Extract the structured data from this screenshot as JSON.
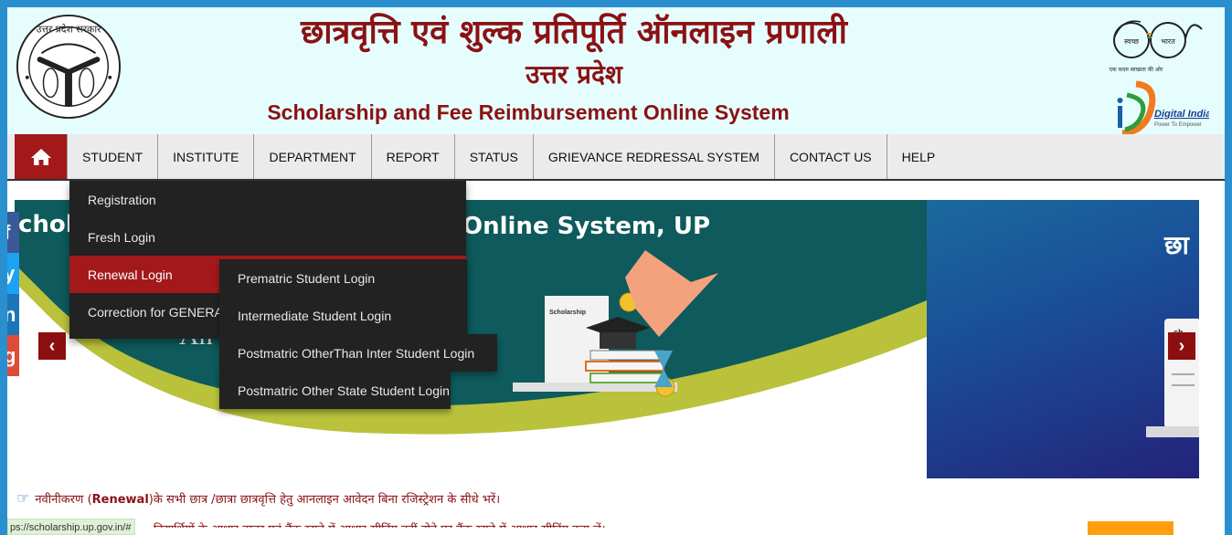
{
  "header": {
    "title_hindi": "छात्रवृत्ति एवं शुल्क प्रतिपूर्ति ऑनलाइन प्रणाली",
    "state_hindi": "उत्तर प्रदेश",
    "title_english": "Scholarship and Fee Reimbursement Online System",
    "emblem_text": "उत्तर प्रदेश सरकार",
    "swachh_left": "स्वच्छ",
    "swachh_right": "भारत",
    "swachh_tagline": "एक कदम स्वच्छता की ओर",
    "digital_india": "Digital India",
    "digital_tagline": "Power To Empower"
  },
  "nav": {
    "home_icon": "home-icon",
    "items": [
      {
        "label": "STUDENT"
      },
      {
        "label": "INSTITUTE"
      },
      {
        "label": "DEPARTMENT"
      },
      {
        "label": "REPORT"
      },
      {
        "label": "STATUS"
      },
      {
        "label": "GRIEVANCE REDRESSAL SYSTEM"
      },
      {
        "label": "CONTACT US"
      },
      {
        "label": "HELP"
      }
    ]
  },
  "student_menu": {
    "items": [
      {
        "label": "Registration"
      },
      {
        "label": "Fresh Login"
      },
      {
        "label": "Renewal Login",
        "active": true
      },
      {
        "label": "Correction for GENERAL"
      }
    ],
    "renewal_submenu": [
      {
        "label": "Prematric Student Login"
      },
      {
        "label": "Intermediate Student Login"
      },
      {
        "label": "Postmatric OtherThan Inter Student Login"
      },
      {
        "label": "Postmatric Other State Student Login"
      }
    ]
  },
  "banner": {
    "slide1_heading_left": "chol",
    "slide1_heading_right": "Online System, UP",
    "slide1_sub": "An   ...   nic",
    "slide1_doc_label": "Scholarship",
    "slide2_heading": "छा",
    "slide2_doc_label": "ch",
    "prev_label": "‹",
    "next_label": "›"
  },
  "social": [
    "facebook",
    "twitter",
    "linkedin",
    "google-plus"
  ],
  "notices": {
    "line1_prefix": "नवीनीकरण (",
    "line1_bold": "Renewal",
    "line1_suffix": ")के सभी छात्र /छात्रा छात्रवृत्ति हेतु आनलाइन आवेदन बिना रजिस्ट्रेशन के सीधे भरें।",
    "line2": "विद्यार्थियों के आधार नम्बर एवं बैंक खाते में आधार सीडिंग नहीं होने पर बैंक खाते में आधार सीडिंग करा लें।"
  },
  "status_bar": {
    "url": "ps://scholarship.up.gov.in/#"
  },
  "colors": {
    "frame": "#2a8fcf",
    "header_bg": "#e6fdfe",
    "title": "#8b1113",
    "nav_bg": "#ebebeb",
    "accent_red": "#a3191a",
    "menu_bg": "#222222",
    "banner_teal": "#0e5a5c",
    "banner_olive": "#b9c23a"
  }
}
